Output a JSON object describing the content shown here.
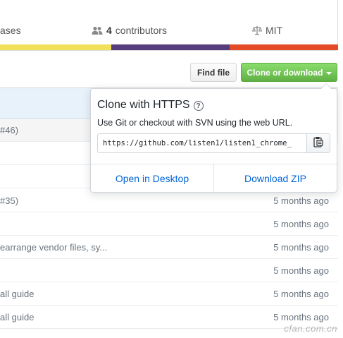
{
  "summary": {
    "releases_label": "ases",
    "contributors_count": "4",
    "contributors_label": "contributors",
    "license_label": "MIT",
    "icons": {
      "contributors": "people-icon",
      "license": "law-icon"
    },
    "language_colors": [
      "#f1e05a",
      "#563d7c",
      "#e34c26"
    ],
    "language_shares": [
      0.33,
      0.35,
      0.32
    ]
  },
  "toolbar": {
    "find_file_label": "Find file",
    "clone_label": "Clone or download",
    "clone_icon": "caret-down-icon"
  },
  "clone_popover": {
    "title": "Clone with HTTPS",
    "help_icon": "question-icon",
    "description": "Use Git or checkout with SVN using the web URL.",
    "url": "https://github.com/listen1/listen1_chrome_",
    "copy_icon": "clipboard-icon",
    "open_desktop_label": "Open in Desktop",
    "download_zip_label": "Download ZIP"
  },
  "files": {
    "rows": [
      {
        "message": "#46)",
        "age": ""
      },
      {
        "message": "",
        "age": ""
      },
      {
        "message": "",
        "age": ""
      },
      {
        "message": "#35)",
        "age": "5 months ago"
      },
      {
        "message": "",
        "age": "5 months ago"
      },
      {
        "message": "earrange vendor files, sy...",
        "age": "5 months ago"
      },
      {
        "message": "",
        "age": "5 months ago"
      },
      {
        "message": "all guide",
        "age": "5 months ago"
      },
      {
        "message": "all guide",
        "age": "5 months ago"
      }
    ]
  },
  "watermark": "cfan.com.cn",
  "colors": {
    "clone_button": "#60b044",
    "link": "#0366d6",
    "header_row": "#e8f2fb"
  }
}
